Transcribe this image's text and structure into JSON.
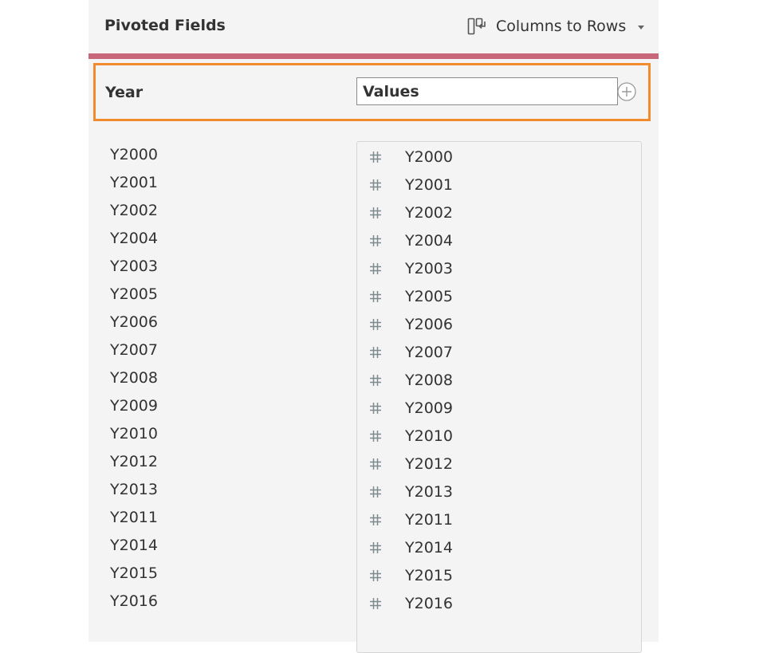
{
  "header": {
    "title": "Pivoted Fields",
    "pivot_type": "Columns to Rows",
    "pivot_icon": "pivot-columns-to-rows-icon"
  },
  "pivot_row": {
    "names_field_label": "Year",
    "values_field_value": "Values",
    "add_icon": "plus-circle-icon"
  },
  "colors": {
    "accent_bar": "#c8677a",
    "selection_border": "#f28a2e",
    "panel_background": "#f4f4f4"
  },
  "pivot_values": [
    "Y2000",
    "Y2001",
    "Y2002",
    "Y2004",
    "Y2003",
    "Y2005",
    "Y2006",
    "Y2007",
    "Y2008",
    "Y2009",
    "Y2010",
    "Y2012",
    "Y2013",
    "Y2011",
    "Y2014",
    "Y2015",
    "Y2016"
  ],
  "source_fields": [
    {
      "type_icon": "number-hash-icon",
      "name": "Y2000"
    },
    {
      "type_icon": "number-hash-icon",
      "name": "Y2001"
    },
    {
      "type_icon": "number-hash-icon",
      "name": "Y2002"
    },
    {
      "type_icon": "number-hash-icon",
      "name": "Y2004"
    },
    {
      "type_icon": "number-hash-icon",
      "name": "Y2003"
    },
    {
      "type_icon": "number-hash-icon",
      "name": "Y2005"
    },
    {
      "type_icon": "number-hash-icon",
      "name": "Y2006"
    },
    {
      "type_icon": "number-hash-icon",
      "name": "Y2007"
    },
    {
      "type_icon": "number-hash-icon",
      "name": "Y2008"
    },
    {
      "type_icon": "number-hash-icon",
      "name": "Y2009"
    },
    {
      "type_icon": "number-hash-icon",
      "name": "Y2010"
    },
    {
      "type_icon": "number-hash-icon",
      "name": "Y2012"
    },
    {
      "type_icon": "number-hash-icon",
      "name": "Y2013"
    },
    {
      "type_icon": "number-hash-icon",
      "name": "Y2011"
    },
    {
      "type_icon": "number-hash-icon",
      "name": "Y2014"
    },
    {
      "type_icon": "number-hash-icon",
      "name": "Y2015"
    },
    {
      "type_icon": "number-hash-icon",
      "name": "Y2016"
    }
  ]
}
